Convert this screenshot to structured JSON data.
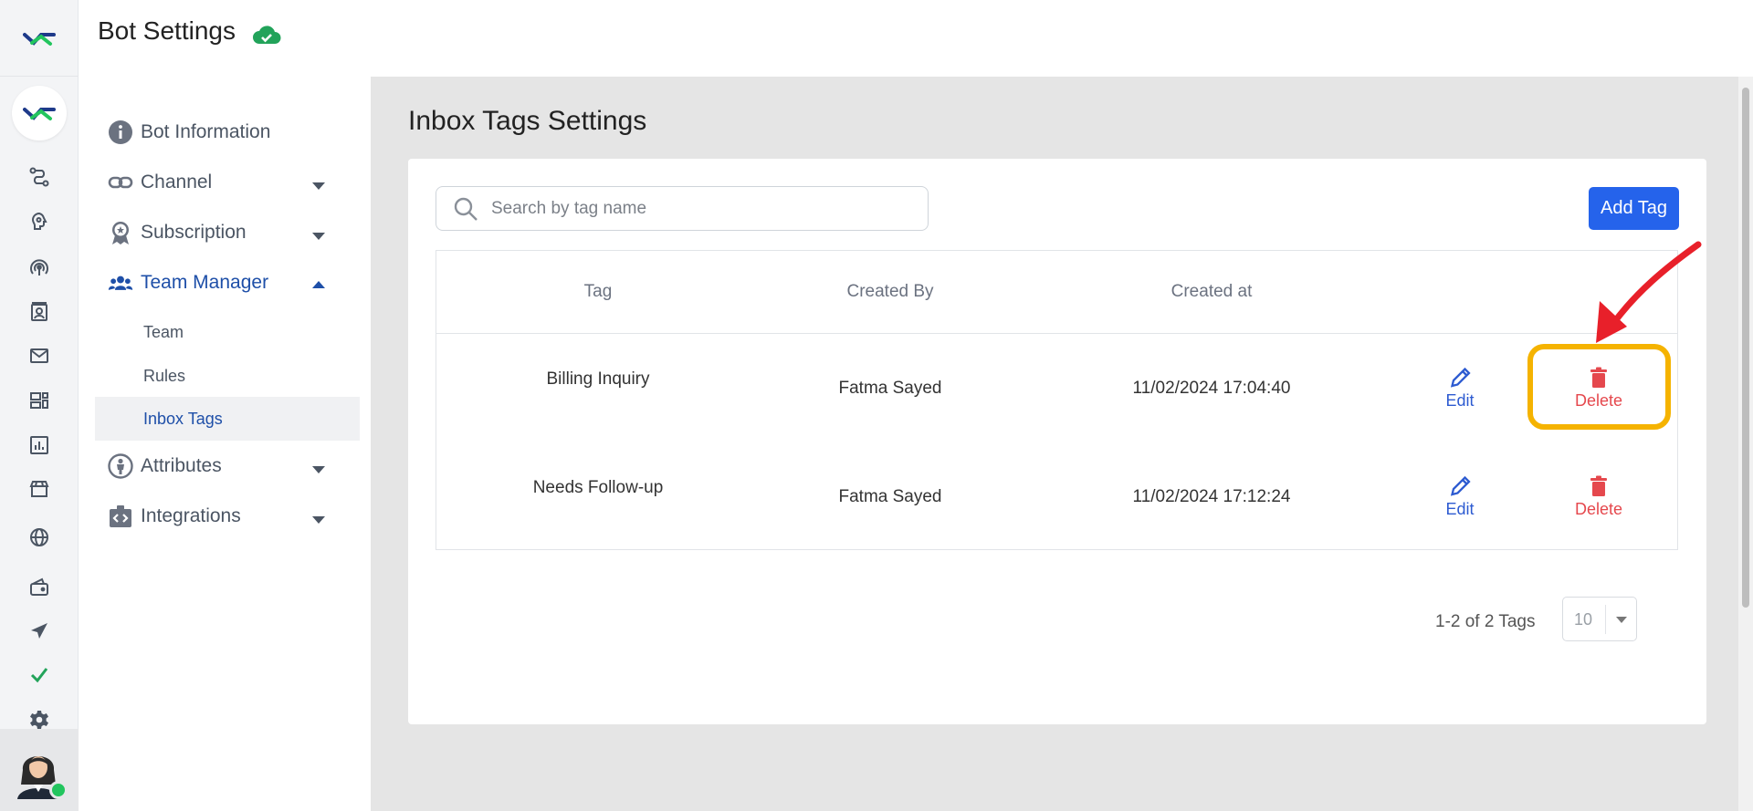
{
  "header": {
    "title": "Bot Settings",
    "status_icon": "cloud-check-icon"
  },
  "rail": {
    "icons": [
      "flow-icon",
      "brain-icon",
      "broadcast-icon",
      "contacts-icon",
      "mail-icon",
      "widgets-icon",
      "analytics-icon",
      "store-icon",
      "globe-icon",
      "wallet-icon",
      "send-icon",
      "check-icon",
      "gear-icon"
    ],
    "online_color": "#22c55e"
  },
  "sidebar": {
    "items": [
      {
        "label": "Bot Information",
        "icon": "info-icon"
      },
      {
        "label": "Channel",
        "icon": "link-icon"
      },
      {
        "label": "Subscription",
        "icon": "badge-icon"
      },
      {
        "label": "Team Manager",
        "icon": "team-icon"
      },
      {
        "label": "Attributes",
        "icon": "person-icon"
      },
      {
        "label": "Integrations",
        "icon": "integration-icon"
      }
    ],
    "sub_items": [
      "Team",
      "Rules",
      "Inbox Tags"
    ],
    "selected_sub": "Inbox Tags"
  },
  "main": {
    "title": "Inbox Tags Settings",
    "search_placeholder": "Search by tag name",
    "add_button": "Add Tag",
    "columns": [
      "Tag",
      "Created By",
      "Created at"
    ],
    "rows": [
      {
        "tag": "Billing Inquiry",
        "created_by": "Fatma Sayed",
        "created_at": "11/02/2024 17:04:40",
        "edit": "Edit",
        "delete": "Delete"
      },
      {
        "tag": "Needs Follow-up",
        "created_by": "Fatma Sayed",
        "created_at": "11/02/2024 17:12:24",
        "edit": "Edit",
        "delete": "Delete"
      }
    ],
    "pagination": {
      "summary": "1-2 of 2 Tags",
      "page_size": "10"
    }
  },
  "colors": {
    "primary": "#2563eb",
    "active_nav": "#1e4fa8",
    "delete": "#e5484d",
    "highlight": "#f5b300",
    "annotation_arrow": "#e8202a"
  }
}
